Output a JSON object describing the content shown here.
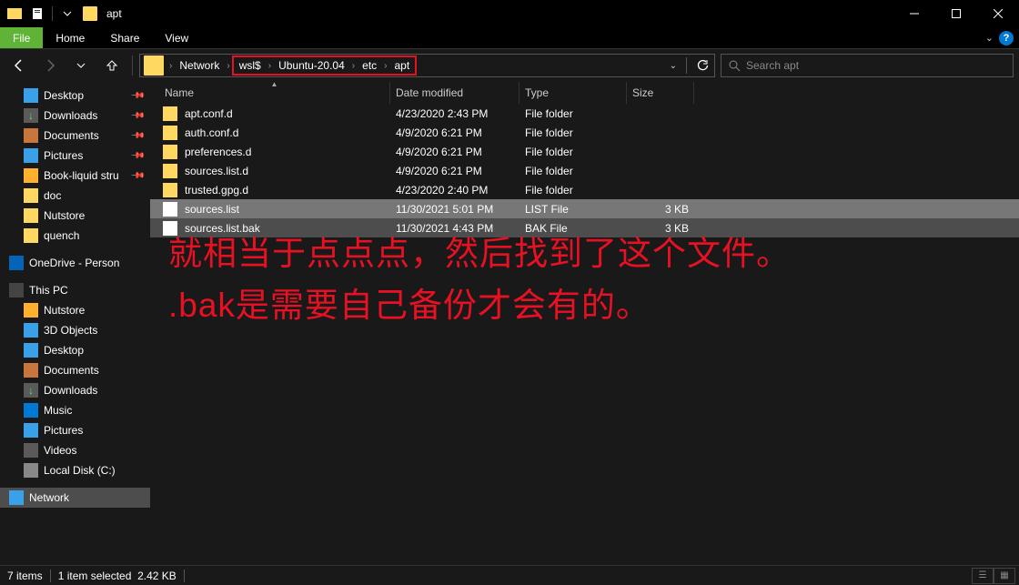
{
  "title": "apt",
  "ribbon": {
    "file": "File",
    "home": "Home",
    "share": "Share",
    "view": "View"
  },
  "breadcrumb": {
    "root": "Network",
    "b1": "wsl$",
    "b2": "Ubuntu-20.04",
    "b3": "etc",
    "b4": "apt"
  },
  "search": {
    "placeholder": "Search apt"
  },
  "columns": {
    "name": "Name",
    "date": "Date modified",
    "type": "Type",
    "size": "Size"
  },
  "sidebar": {
    "quick": [
      {
        "label": "Desktop",
        "icon": "ico-desktop",
        "pin": true
      },
      {
        "label": "Downloads",
        "icon": "ico-down",
        "pin": true
      },
      {
        "label": "Documents",
        "icon": "ico-doc",
        "pin": true
      },
      {
        "label": "Pictures",
        "icon": "ico-pic",
        "pin": true
      },
      {
        "label": "Book-liquid stru",
        "icon": "ico-folder-y",
        "pin": true
      },
      {
        "label": "doc",
        "icon": "ico-folder",
        "pin": false
      },
      {
        "label": "Nutstore",
        "icon": "ico-folder",
        "pin": false
      },
      {
        "label": "quench",
        "icon": "ico-folder",
        "pin": false
      }
    ],
    "onedrive": "OneDrive - Person",
    "thispc": "This PC",
    "pc": [
      {
        "label": "Nutstore",
        "icon": "ico-folder-y"
      },
      {
        "label": "3D Objects",
        "icon": "ico-3d"
      },
      {
        "label": "Desktop",
        "icon": "ico-desktop"
      },
      {
        "label": "Documents",
        "icon": "ico-doc"
      },
      {
        "label": "Downloads",
        "icon": "ico-down"
      },
      {
        "label": "Music",
        "icon": "ico-music"
      },
      {
        "label": "Pictures",
        "icon": "ico-pic"
      },
      {
        "label": "Videos",
        "icon": "ico-video"
      },
      {
        "label": "Local Disk (C:)",
        "icon": "ico-disk"
      }
    ],
    "network": "Network"
  },
  "files": [
    {
      "name": "apt.conf.d",
      "date": "4/23/2020 2:43 PM",
      "type": "File folder",
      "size": "",
      "icon": "ri-folder"
    },
    {
      "name": "auth.conf.d",
      "date": "4/9/2020 6:21 PM",
      "type": "File folder",
      "size": "",
      "icon": "ri-folder"
    },
    {
      "name": "preferences.d",
      "date": "4/9/2020 6:21 PM",
      "type": "File folder",
      "size": "",
      "icon": "ri-folder"
    },
    {
      "name": "sources.list.d",
      "date": "4/9/2020 6:21 PM",
      "type": "File folder",
      "size": "",
      "icon": "ri-folder"
    },
    {
      "name": "trusted.gpg.d",
      "date": "4/23/2020 2:40 PM",
      "type": "File folder",
      "size": "",
      "icon": "ri-folder"
    },
    {
      "name": "sources.list",
      "date": "11/30/2021 5:01 PM",
      "type": "LIST File",
      "size": "3 KB",
      "icon": "ri-file",
      "sel": "sel"
    },
    {
      "name": "sources.list.bak",
      "date": "11/30/2021 4:43 PM",
      "type": "BAK File",
      "size": "3 KB",
      "icon": "ri-file",
      "sel": "sel2"
    }
  ],
  "annotation": {
    "line1": "就相当于点点点，然后找到了这个文件。",
    "line2": ".bak是需要自己备份才会有的。"
  },
  "status": {
    "count": "7 items",
    "selected": "1 item selected",
    "size": "2.42 KB"
  }
}
